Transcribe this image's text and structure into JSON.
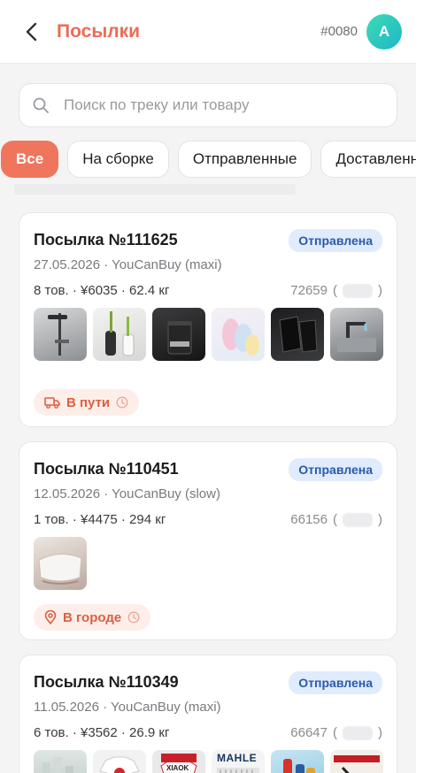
{
  "header": {
    "title": "Посылки",
    "user_id": "#0080",
    "avatar_letter": "A",
    "back_icon": "chevron-left-icon"
  },
  "search": {
    "placeholder": "Поиск по треку или товару",
    "value": ""
  },
  "filters": [
    {
      "label": "Все",
      "active": true
    },
    {
      "label": "На сборке",
      "active": false
    },
    {
      "label": "Отправленные",
      "active": false
    },
    {
      "label": "Доставленные",
      "active": false
    }
  ],
  "parcels": [
    {
      "title": "Посылка №111625",
      "status": "Отправлена",
      "subtitle": "27.05.2026 · YouCanBuy (maxi)",
      "stats": "8 тов. · ¥6035 · 62.4 кг",
      "track": "72659",
      "delivery": "В пути",
      "delivery_icon": "truck-icon",
      "thumbs": [
        "shower-set",
        "toilet-brush",
        "bathroom-bin",
        "socks-pack",
        "car-mats",
        "faucet"
      ]
    },
    {
      "title": "Посылка №110451",
      "status": "Отправлена",
      "subtitle": "12.05.2026 · YouCanBuy (slow)",
      "stats": "1 тов. · ¥4475 · 294 кг",
      "track": "66156",
      "delivery": "В городе",
      "delivery_icon": "pin-icon",
      "thumbs": [
        "bathtub"
      ]
    },
    {
      "title": "Посылка №110349",
      "status": "Отправлена",
      "subtitle": "11.05.2026 · YouCanBuy (maxi)",
      "stats": "6 тов. · ¥3562 · 26.9 кг",
      "track": "66647",
      "thumbs": [
        "city-print",
        "tshirt-white",
        "tshirt-red",
        "mahle-filter",
        "bottles",
        "poster"
      ],
      "thumb_texts": {
        "mahle": "MAHLE",
        "xiaok": "XIAOK"
      }
    }
  ],
  "colors": {
    "accent": "#ee6b55",
    "badge_bg": "#e0ecfd",
    "badge_text": "#2b5aa8",
    "pill_bg": "#fdeee9",
    "pill_text": "#dc5f43"
  }
}
